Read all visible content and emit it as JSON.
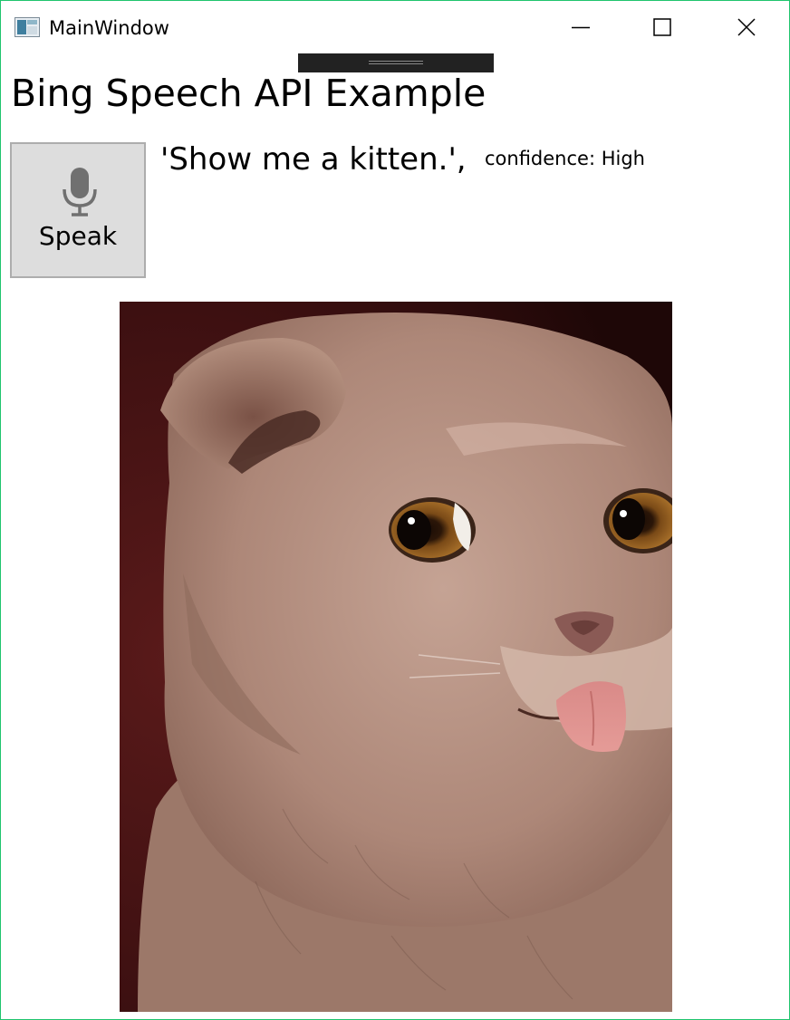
{
  "window": {
    "title": "MainWindow",
    "controls": {
      "minimize": "minimize-icon",
      "maximize": "maximize-icon",
      "close": "close-icon"
    }
  },
  "main": {
    "heading": "Bing Speech API Example",
    "speak_button": {
      "label": "Speak",
      "icon": "microphone-icon"
    },
    "recognized_text": "'Show me a kitten.',",
    "confidence_text": "confidence: High",
    "image": {
      "subject": "kitten"
    }
  },
  "colors": {
    "window_border": "#1fc46e",
    "button_background": "#dddddd",
    "button_border": "#adadad",
    "icon_gray": "#707070"
  }
}
